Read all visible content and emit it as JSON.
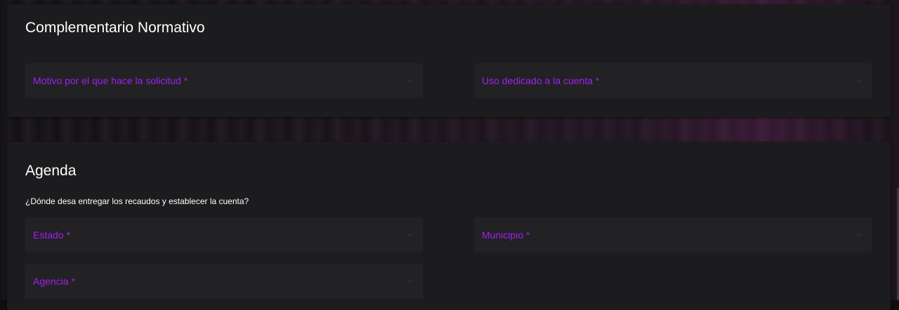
{
  "colors": {
    "page_background": "#0e0d10",
    "card_background": "#1c1b1d",
    "field_background": "#222124",
    "accent_label": "#a020f0",
    "title_text": "#ffffff"
  },
  "complementario": {
    "title": "Complementario Normativo",
    "fields": {
      "motivo": {
        "label": "Motivo por el que hace la solicitud *",
        "icon": "dropdown-arrow"
      },
      "uso": {
        "label": "Uso dedicado a la cuenta *",
        "icon": "dropdown-arrow"
      }
    }
  },
  "agenda": {
    "title": "Agenda",
    "subtitle": "¿Dónde desa entregar los recaudos y establecer la cuenta?",
    "fields": {
      "estado": {
        "label": "Estado *",
        "icon": "dropdown-arrow"
      },
      "municipio": {
        "label": "Municipio *",
        "icon": "dropdown-arrow"
      },
      "agencia": {
        "label": "Agencia *",
        "icon": "dropdown-arrow"
      }
    }
  }
}
